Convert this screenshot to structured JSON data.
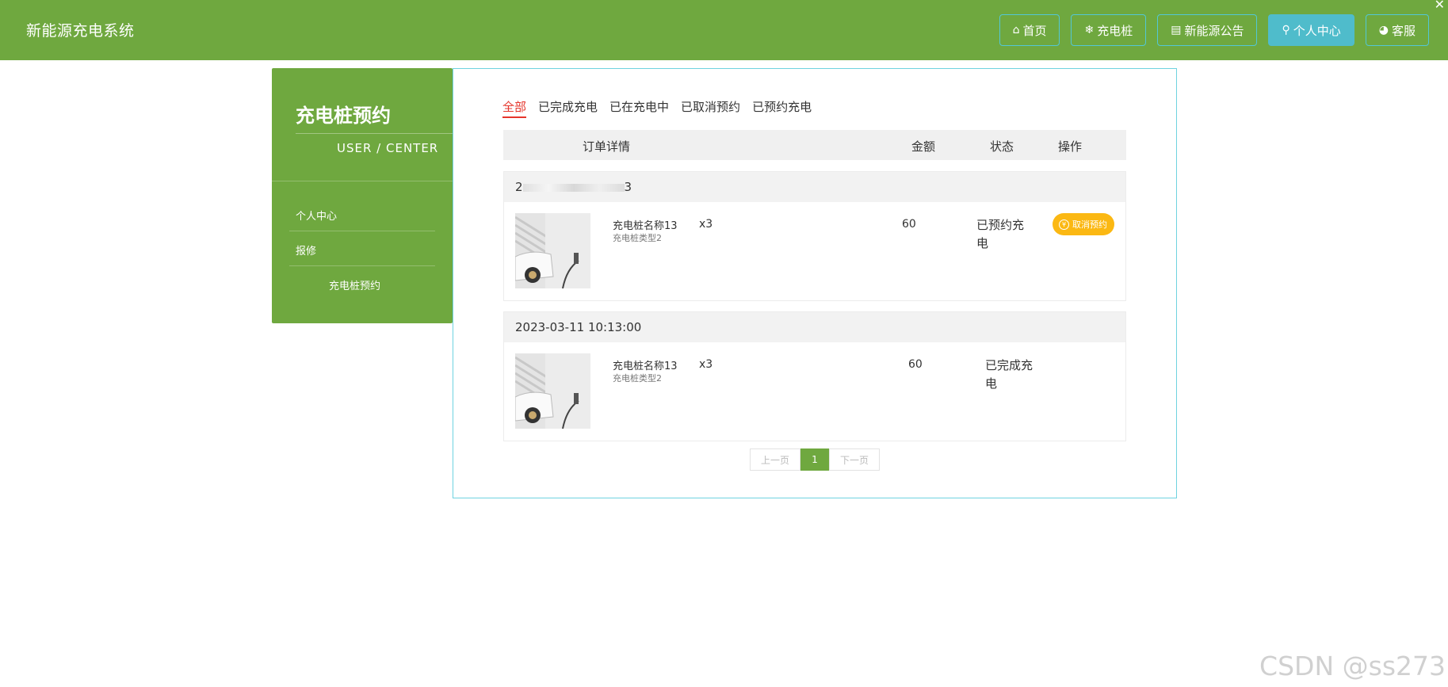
{
  "header": {
    "brand": "新能源充电系统",
    "nav": [
      {
        "icon": "home-icon",
        "glyph": "⌂",
        "label": "首页"
      },
      {
        "icon": "snowflake-icon",
        "glyph": "❄",
        "label": "充电桩"
      },
      {
        "icon": "newspaper-icon",
        "glyph": "▤",
        "label": "新能源公告"
      },
      {
        "icon": "user-icon",
        "glyph": "⚲",
        "label": "个人中心"
      },
      {
        "icon": "headset-icon",
        "glyph": "◕",
        "label": "客服"
      }
    ],
    "close_glyph": "✕"
  },
  "sidebar": {
    "title": "充电桩预约",
    "subtitle": "USER / CENTER",
    "items": [
      {
        "label": "个人中心"
      },
      {
        "label": "报修"
      },
      {
        "label": "充电桩预约"
      }
    ]
  },
  "main": {
    "tabs": [
      "全部",
      "已完成充电",
      "已在充电中",
      "已取消预约",
      "已预约充电"
    ],
    "active_tab": "全部",
    "columns": [
      "订单详情",
      "金额",
      "状态",
      "操作"
    ],
    "orders": [
      {
        "order_head_prefix": "2",
        "order_head_suffix": "3",
        "name": "充电桩名称13",
        "type": "充电桩类型2",
        "qty": "x3",
        "amount": "60",
        "status": "已预约充电",
        "action": "取消预约",
        "action_icon": "yen-icon"
      },
      {
        "order_head": "2023-03-11 10:13:00",
        "name": "充电桩名称13",
        "type": "充电桩类型2",
        "qty": "x3",
        "amount": "60",
        "status": "已完成充电"
      }
    ],
    "pager": {
      "prev": "上一页",
      "current": "1",
      "next": "下一页"
    }
  },
  "watermark": "CSDN @ss273",
  "colors": {
    "brand_green": "#6fa83f",
    "accent_cyan": "#4fbccb",
    "tab_active": "#e5352b",
    "cancel_btn": "#fbb813"
  }
}
